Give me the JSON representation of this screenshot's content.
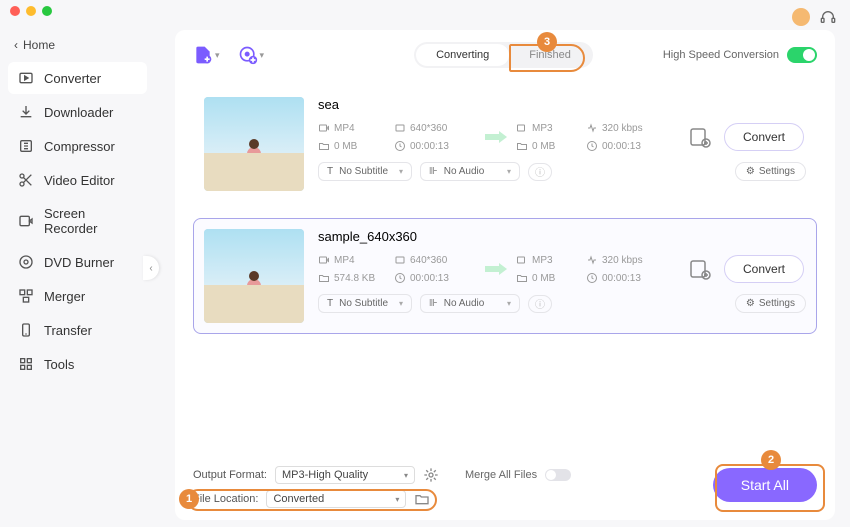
{
  "window": {
    "home": "Home"
  },
  "sidebar": {
    "items": [
      {
        "label": "Converter",
        "active": true
      },
      {
        "label": "Downloader"
      },
      {
        "label": "Compressor"
      },
      {
        "label": "Video Editor"
      },
      {
        "label": "Screen Recorder"
      },
      {
        "label": "DVD Burner"
      },
      {
        "label": "Merger"
      },
      {
        "label": "Transfer"
      },
      {
        "label": "Tools"
      }
    ]
  },
  "tabs": {
    "converting": "Converting",
    "finished": "Finished"
  },
  "hsc": "High Speed Conversion",
  "items": [
    {
      "title": "sea",
      "src": {
        "fmt": "MP4",
        "res": "640*360",
        "size": "0 MB",
        "dur": "00:00:13"
      },
      "dst": {
        "fmt": "MP3",
        "size": "0 MB",
        "rate": "320 kbps",
        "dur": "00:00:13"
      },
      "subtitle": "No Subtitle",
      "audio": "No Audio",
      "settings": "Settings",
      "convert": "Convert"
    },
    {
      "title": "sample_640x360",
      "src": {
        "fmt": "MP4",
        "res": "640*360",
        "size": "574.8 KB",
        "dur": "00:00:13"
      },
      "dst": {
        "fmt": "MP3",
        "size": "0 MB",
        "rate": "320 kbps",
        "dur": "00:00:13"
      },
      "subtitle": "No Subtitle",
      "audio": "No Audio",
      "settings": "Settings",
      "convert": "Convert"
    }
  ],
  "footer": {
    "outputFormatLabel": "Output Format:",
    "outputFormat": "MP3-High Quality",
    "fileLocationLabel": "File Location:",
    "fileLocation": "Converted",
    "mergeLabel": "Merge All Files",
    "startAll": "Start All"
  },
  "annotations": {
    "a1": "1",
    "a2": "2",
    "a3": "3"
  }
}
